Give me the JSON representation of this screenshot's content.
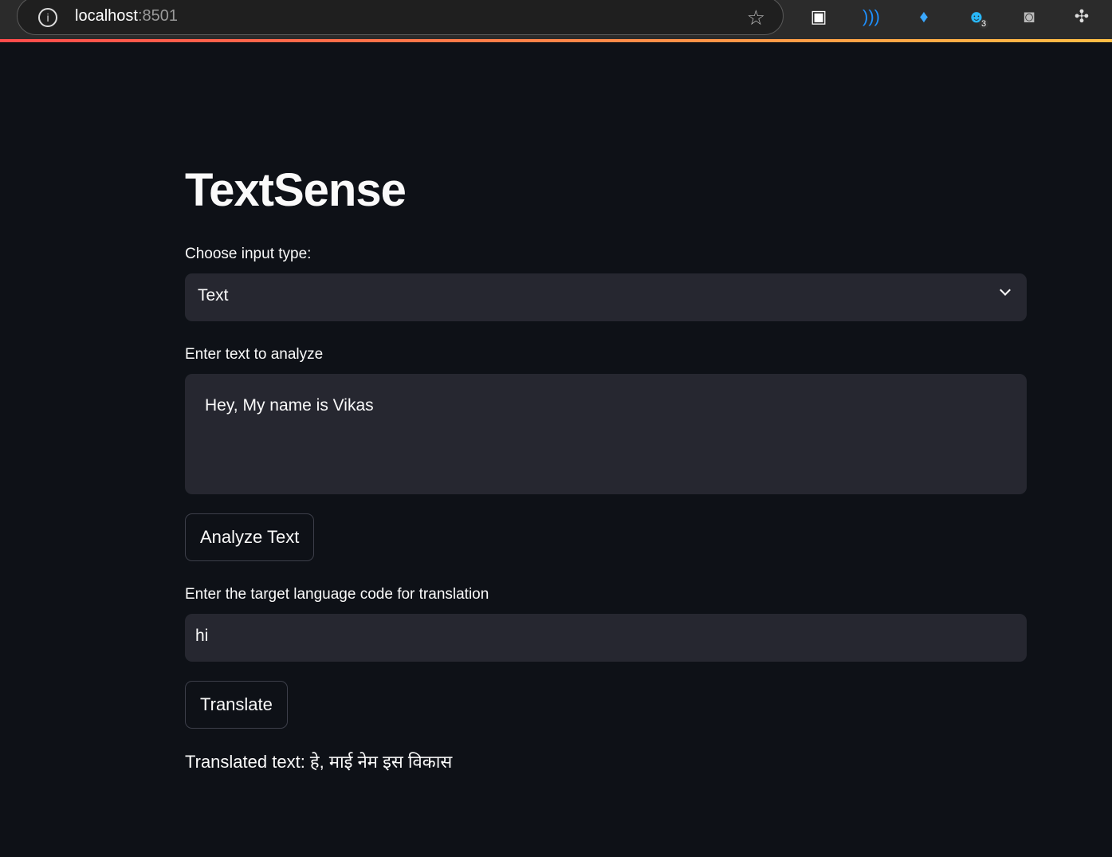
{
  "browser": {
    "host": "localhost",
    "port": ":8501",
    "ext_badge": "3"
  },
  "app": {
    "title": "TextSense",
    "input_type": {
      "label": "Choose input type:",
      "selected": "Text"
    },
    "text_input": {
      "label": "Enter text to analyze",
      "value": "Hey, My name is Vikas"
    },
    "analyze_button": "Analyze Text",
    "lang_input": {
      "label": "Enter the target language code for translation",
      "value": "hi"
    },
    "translate_button": "Translate",
    "result": {
      "prefix": "Translated text: ",
      "value": "हे, माई नेम इस विकास"
    }
  },
  "colors": {
    "background": "#0e1117",
    "input_bg": "#262730",
    "accent_gradient": [
      "#ff4b4b",
      "#ffbd45"
    ]
  }
}
